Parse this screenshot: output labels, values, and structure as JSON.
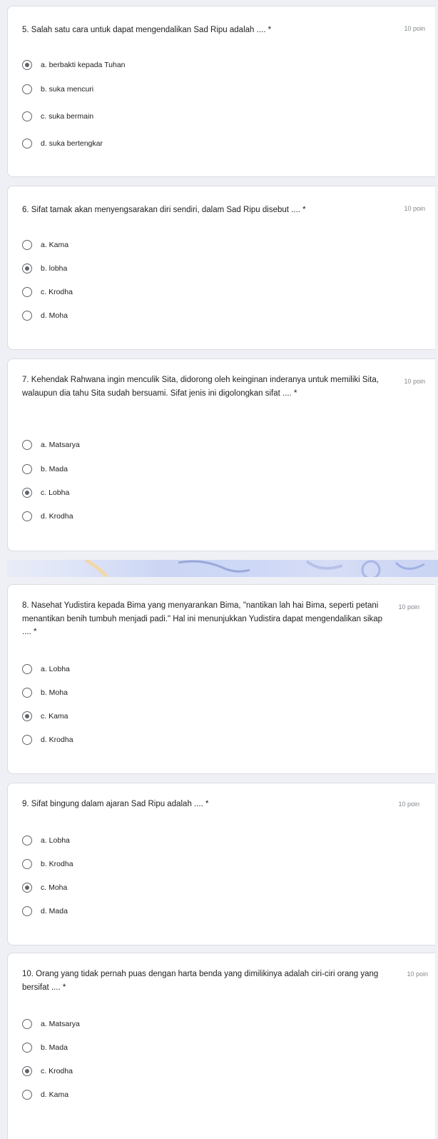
{
  "questions": [
    {
      "title": "5. Salah satu cara untuk dapat mengendalikan Sad Ripu adalah .... *",
      "points": "10 poin",
      "options": [
        "a. berbakti kepada Tuhan",
        "b. suka mencuri",
        "c. suka bermain",
        "d. suka bertengkar"
      ],
      "selected": 0
    },
    {
      "title": "6. Sifat tamak akan menyengsarakan diri sendiri, dalam Sad Ripu disebut .... *",
      "points": "10 poin",
      "options": [
        "a. Kama",
        "b. lobha",
        "c. Krodha",
        "d. Moha"
      ],
      "selected": 1
    },
    {
      "title": "7. Kehendak Rahwana ingin menculik Sita, didorong oleh keinginan inderanya untuk memiliki Sita, walaupun dia tahu Sita sudah bersuami. Sifat jenis ini digolongkan sifat .... *",
      "points": "10 poin",
      "options": [
        "a. Matsarya",
        "b. Mada",
        "c. Lobha",
        "d. Krodha"
      ],
      "selected": 2
    },
    {
      "title": "8. Nasehat Yudistira kepada Bima yang menyarankan Bima, \"nantikan lah hai Bima, seperti petani menantikan benih tumbuh menjadi padi.\" Hal ini menunjukkan Yudistira dapat mengendalikan sikap .... *",
      "points": "10 poin",
      "options": [
        "a. Lobha",
        "b. Moha",
        "c. Kama",
        "d. Krodha"
      ],
      "selected": 2
    },
    {
      "title": "9. Sifat bingung dalam ajaran Sad Ripu adalah .... *",
      "points": "10 poin",
      "options": [
        "a. Lobha",
        "b. Krodha",
        "c. Moha",
        "d. Mada"
      ],
      "selected": 2
    },
    {
      "title": "10. Orang yang tidak pernah puas dengan harta benda yang dimilikinya adalah ciri-ciri orang yang bersifat .... *",
      "points": "10 poin",
      "options": [
        "a. Matsarya",
        "b. Mada",
        "c. Krodha",
        "d. Kama"
      ],
      "selected": 2
    }
  ],
  "colors": {
    "page_background": "#eef0f6",
    "card_background": "#ffffff",
    "radio": "#5f6368",
    "points_text": "#80868b"
  }
}
